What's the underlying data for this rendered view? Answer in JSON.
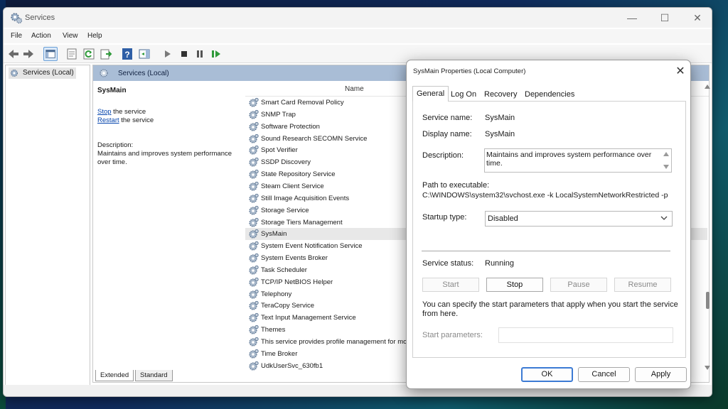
{
  "window": {
    "title": "Services",
    "controls": {
      "minimize": "—",
      "maximize": "☐",
      "close": "✕"
    }
  },
  "menu": [
    "File",
    "Action",
    "View",
    "Help"
  ],
  "toolbar": {
    "icons": [
      "back-arrow-icon",
      "forward-arrow-icon",
      "show-hide-console-tree-icon",
      "properties-icon",
      "refresh-icon",
      "export-list-icon",
      "help-icon",
      "show-action-pane-icon",
      "play-icon",
      "stop-icon",
      "pause-icon",
      "resume-icon"
    ]
  },
  "tree": {
    "root_label": "Services (Local)"
  },
  "pane": {
    "header": "Services (Local)",
    "extended": {
      "service_name": "SysMain",
      "stop_link": "Stop",
      "stop_rest": " the service",
      "restart_link": "Restart",
      "restart_rest": " the service",
      "description_label": "Description:",
      "description_text": "Maintains and improves system performance over time."
    },
    "column_name": "Name",
    "rows": [
      "Smart Card Removal Policy",
      "SNMP Trap",
      "Software Protection",
      "Sound Research SECOMN Service",
      "Spot Verifier",
      "SSDP Discovery",
      "State Repository Service",
      "Steam Client Service",
      "Still Image Acquisition Events",
      "Storage Service",
      "Storage Tiers Management",
      "SysMain",
      "System Event Notification Service",
      "System Events Broker",
      "Task Scheduler",
      "TCP/IP NetBIOS Helper",
      "Telephony",
      "TeraCopy Service",
      "Text Input Management Service",
      "Themes",
      "This service provides profile management for mo",
      "Time Broker",
      "UdkUserSvc_630fb1"
    ],
    "selected_row": "SysMain",
    "bottom_tabs": [
      "Extended",
      "Standard"
    ]
  },
  "dialog": {
    "title": "SysMain Properties (Local Computer)",
    "close": "✕",
    "tabs": [
      "General",
      "Log On",
      "Recovery",
      "Dependencies"
    ],
    "active_tab": "General",
    "service_name_label": "Service name:",
    "service_name_value": "SysMain",
    "display_name_label": "Display name:",
    "display_name_value": "SysMain",
    "description_label": "Description:",
    "description_value": "Maintains and improves system performance over time.",
    "path_label": "Path to executable:",
    "path_value": "C:\\WINDOWS\\system32\\svchost.exe -k LocalSystemNetworkRestricted -p",
    "startup_type_label": "Startup type:",
    "startup_type_value": "Disabled",
    "status_label": "Service status:",
    "status_value": "Running",
    "buttons": {
      "start": "Start",
      "stop": "Stop",
      "pause": "Pause",
      "resume": "Resume"
    },
    "hint": "You can specify the start parameters that apply when you start the service from here.",
    "start_params_label": "Start parameters:",
    "start_params_value": "",
    "footer": {
      "ok": "OK",
      "cancel": "Cancel",
      "apply": "Apply"
    }
  }
}
